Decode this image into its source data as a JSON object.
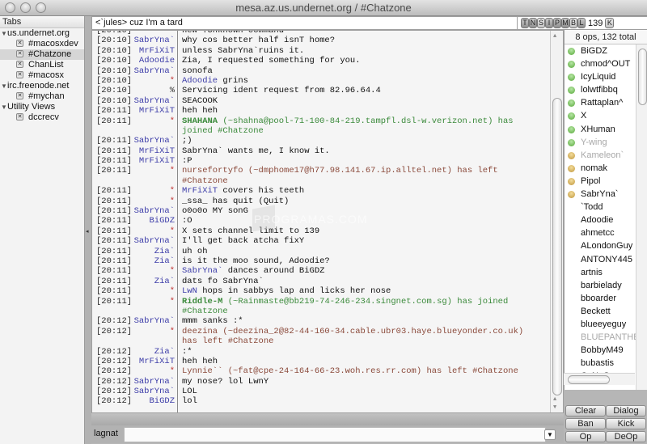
{
  "window": {
    "title": "mesa.az.us.undernet.org / #Chatzone"
  },
  "tabs": {
    "header": "Tabs",
    "groups": [
      {
        "label": "us.undernet.org",
        "items": [
          "#macosxdev",
          "#Chatzone",
          "ChanList",
          "#macosx"
        ],
        "selected": "#Chatzone"
      },
      {
        "label": "irc.freenode.net",
        "items": [
          "#mychan"
        ]
      },
      {
        "label": "Utility Views",
        "items": [
          "dccrecv"
        ]
      }
    ]
  },
  "topic": {
    "text": "<`jules> cuz I'm a tard"
  },
  "channel_modes": {
    "flags": [
      "T",
      "N",
      "S",
      "I",
      "P",
      "M",
      "B",
      "L"
    ],
    "limit": "139",
    "key_button": "K"
  },
  "chat": {
    "lines": [
      {
        "ts": "[20:10]",
        "nick": "*",
        "type": "action",
        "msg": "new :Unknown command"
      },
      {
        "ts": "[20:10]",
        "nick": "SabrYna`",
        "type": "msg",
        "msg": "why cos better half isnT home?"
      },
      {
        "ts": "[20:10]",
        "nick": "MrFiXiT",
        "type": "msg",
        "msg": "unless SabrYna`ruins it."
      },
      {
        "ts": "[20:10]",
        "nick": "Adoodie",
        "type": "msg",
        "msg": "Zia, I requested something for you."
      },
      {
        "ts": "[20:10]",
        "nick": "SabrYna`",
        "type": "msg",
        "msg": "sonofa"
      },
      {
        "ts": "[20:10]",
        "nick": "*",
        "type": "action",
        "actor": "Adoodie",
        "msg": " grins"
      },
      {
        "ts": "[20:10]",
        "nick": "%",
        "type": "server",
        "msg": "Servicing ident request from 82.96.64.4"
      },
      {
        "ts": "[20:10]",
        "nick": "SabrYna`",
        "type": "msg",
        "msg": "SEACOOK"
      },
      {
        "ts": "[20:11]",
        "nick": "MrFiXiT",
        "type": "msg",
        "msg": "heh heh"
      },
      {
        "ts": "[20:11]",
        "nick": "*",
        "type": "join",
        "actor": "SHAHANA",
        "msg": " (~shahna@pool-71-100-84-219.tampfl.dsl-w.verizon.net) has"
      },
      {
        "ts": "",
        "nick": "",
        "type": "join",
        "msg": "joined #Chatzone"
      },
      {
        "ts": "[20:11]",
        "nick": "SabrYna`",
        "type": "msg",
        "msg": ";)"
      },
      {
        "ts": "[20:11]",
        "nick": "MrFiXiT",
        "type": "msg",
        "msg": "SabrYna` wants me, I know it."
      },
      {
        "ts": "[20:11]",
        "nick": "MrFiXiT",
        "type": "msg",
        "msg": ":P"
      },
      {
        "ts": "[20:11]",
        "nick": "*",
        "type": "part",
        "msg": "nursefortyfo (~dmphome17@h77.98.141.67.ip.alltel.net) has left"
      },
      {
        "ts": "",
        "nick": "",
        "type": "part",
        "msg": "#Chatzone"
      },
      {
        "ts": "[20:11]",
        "nick": "*",
        "type": "action",
        "actor": "MrFiXiT",
        "msg": " covers his teeth"
      },
      {
        "ts": "[20:11]",
        "nick": "*",
        "type": "quit",
        "msg": "_ssa_ has quit (Quit)"
      },
      {
        "ts": "[20:11]",
        "nick": "SabrYna`",
        "type": "msg",
        "msg": "o0o0o MY sonG"
      },
      {
        "ts": "[20:11]",
        "nick": "BiGDZ",
        "type": "msg",
        "msg": ":O"
      },
      {
        "ts": "[20:11]",
        "nick": "*",
        "type": "server",
        "msg": "X sets channel limit to 139"
      },
      {
        "ts": "[20:11]",
        "nick": "SabrYna`",
        "type": "msg",
        "msg": "I'll get back atcha fixY"
      },
      {
        "ts": "[20:11]",
        "nick": "Zia`",
        "type": "msg",
        "msg": "uh oh"
      },
      {
        "ts": "[20:11]",
        "nick": "Zia`",
        "type": "msg",
        "msg": "is it the moo sound, Adoodie?"
      },
      {
        "ts": "[20:11]",
        "nick": "*",
        "type": "action",
        "actor": "SabrYna`",
        "msg": " dances around BiGDZ"
      },
      {
        "ts": "[20:11]",
        "nick": "Zia`",
        "type": "msg",
        "msg": "dats fo SabrYna`"
      },
      {
        "ts": "[20:11]",
        "nick": "*",
        "type": "action",
        "actor": "LwN",
        "msg": " hops in sabbys lap and licks her nose"
      },
      {
        "ts": "[20:11]",
        "nick": "*",
        "type": "join",
        "actor": "Riddle-M",
        "msg": " (~Rainmaste@bb219-74-246-234.singnet.com.sg) has joined"
      },
      {
        "ts": "",
        "nick": "",
        "type": "join",
        "msg": "#Chatzone"
      },
      {
        "ts": "[20:12]",
        "nick": "SabrYna`",
        "type": "msg",
        "msg": "mmm sanks :*"
      },
      {
        "ts": "[20:12]",
        "nick": "*",
        "type": "part",
        "msg": "deezina (~deezina_2@82-44-160-34.cable.ubr03.haye.blueyonder.co.uk)"
      },
      {
        "ts": "",
        "nick": "",
        "type": "part",
        "msg": "has left #Chatzone"
      },
      {
        "ts": "[20:12]",
        "nick": "Zia`",
        "type": "msg",
        "msg": ":*"
      },
      {
        "ts": "[20:12]",
        "nick": "MrFiXiT",
        "type": "msg",
        "msg": "heh heh"
      },
      {
        "ts": "[20:12]",
        "nick": "*",
        "type": "part",
        "msg": "Lynnie`` (~fat@cpe-24-164-66-23.woh.res.rr.com) has left #Chatzone"
      },
      {
        "ts": "[20:12]",
        "nick": "SabrYna`",
        "type": "msg",
        "msg": "my nose?  lol LwnY"
      },
      {
        "ts": "[20:12]",
        "nick": "SabrYna`",
        "type": "msg",
        "msg": "LOL"
      },
      {
        "ts": "[20:12]",
        "nick": "BiGDZ",
        "type": "msg",
        "msg": "lol"
      }
    ],
    "watermark": "PROGRAMAS.COM"
  },
  "input": {
    "nick_label": "lagnat",
    "value": "",
    "history_icon": "▼"
  },
  "users": {
    "header": "8 ops, 132 total",
    "list": [
      {
        "name": "BiGDZ",
        "status": "op"
      },
      {
        "name": "chmod^OUT",
        "status": "op"
      },
      {
        "name": "IcyLiquid",
        "status": "op"
      },
      {
        "name": "lolwtfibbq",
        "status": "op"
      },
      {
        "name": "Rattaplan^",
        "status": "op"
      },
      {
        "name": "X",
        "status": "op"
      },
      {
        "name": "XHuman",
        "status": "op"
      },
      {
        "name": "Y-wing",
        "status": "op",
        "away": true
      },
      {
        "name": "Kameleon`",
        "status": "voice",
        "away": true
      },
      {
        "name": "nomak",
        "status": "voice"
      },
      {
        "name": "Pipol",
        "status": "voice"
      },
      {
        "name": "SabrYna`",
        "status": "voice"
      },
      {
        "name": "`Todd",
        "status": "none"
      },
      {
        "name": "Adoodie",
        "status": "none"
      },
      {
        "name": "ahmetcc",
        "status": "none"
      },
      {
        "name": "ALondonGuy",
        "status": "none"
      },
      {
        "name": "ANTONY445",
        "status": "none"
      },
      {
        "name": "artnis",
        "status": "none"
      },
      {
        "name": "barbielady",
        "status": "none"
      },
      {
        "name": "bboarder",
        "status": "none"
      },
      {
        "name": "Beckett",
        "status": "none"
      },
      {
        "name": "blueeyeguy",
        "status": "none"
      },
      {
        "name": "BLUEPANTHER",
        "status": "none",
        "away": true
      },
      {
        "name": "BobbyM49",
        "status": "none"
      },
      {
        "name": "bubastis",
        "status": "none"
      },
      {
        "name": "CaNeS",
        "status": "none"
      }
    ]
  },
  "actions": {
    "clear": "Clear",
    "dialog": "Dialog",
    "ban": "Ban",
    "kick": "Kick",
    "op": "Op",
    "deop": "DeOp"
  }
}
